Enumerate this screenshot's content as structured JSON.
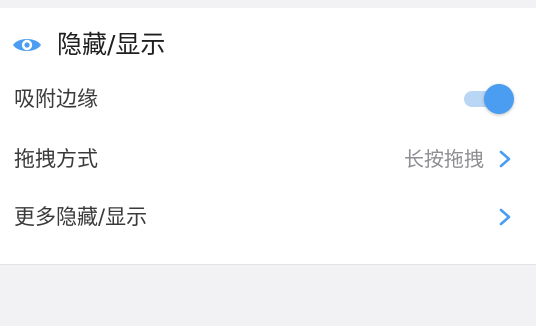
{
  "colors": {
    "accent": "#4a9df0",
    "accent_light": "#b9d6f5",
    "page_background": "#f2f2f5",
    "card_background": "#ffffff"
  },
  "section": {
    "icon": "eye-icon",
    "title": "隐藏/显示"
  },
  "rows": [
    {
      "label": "吸附边缘",
      "control": "toggle",
      "checked": true
    },
    {
      "label": "拖拽方式",
      "value": "长按拖拽",
      "icon": "chevron-right-icon"
    },
    {
      "label": "更多隐藏/显示",
      "icon": "chevron-right-icon"
    }
  ]
}
